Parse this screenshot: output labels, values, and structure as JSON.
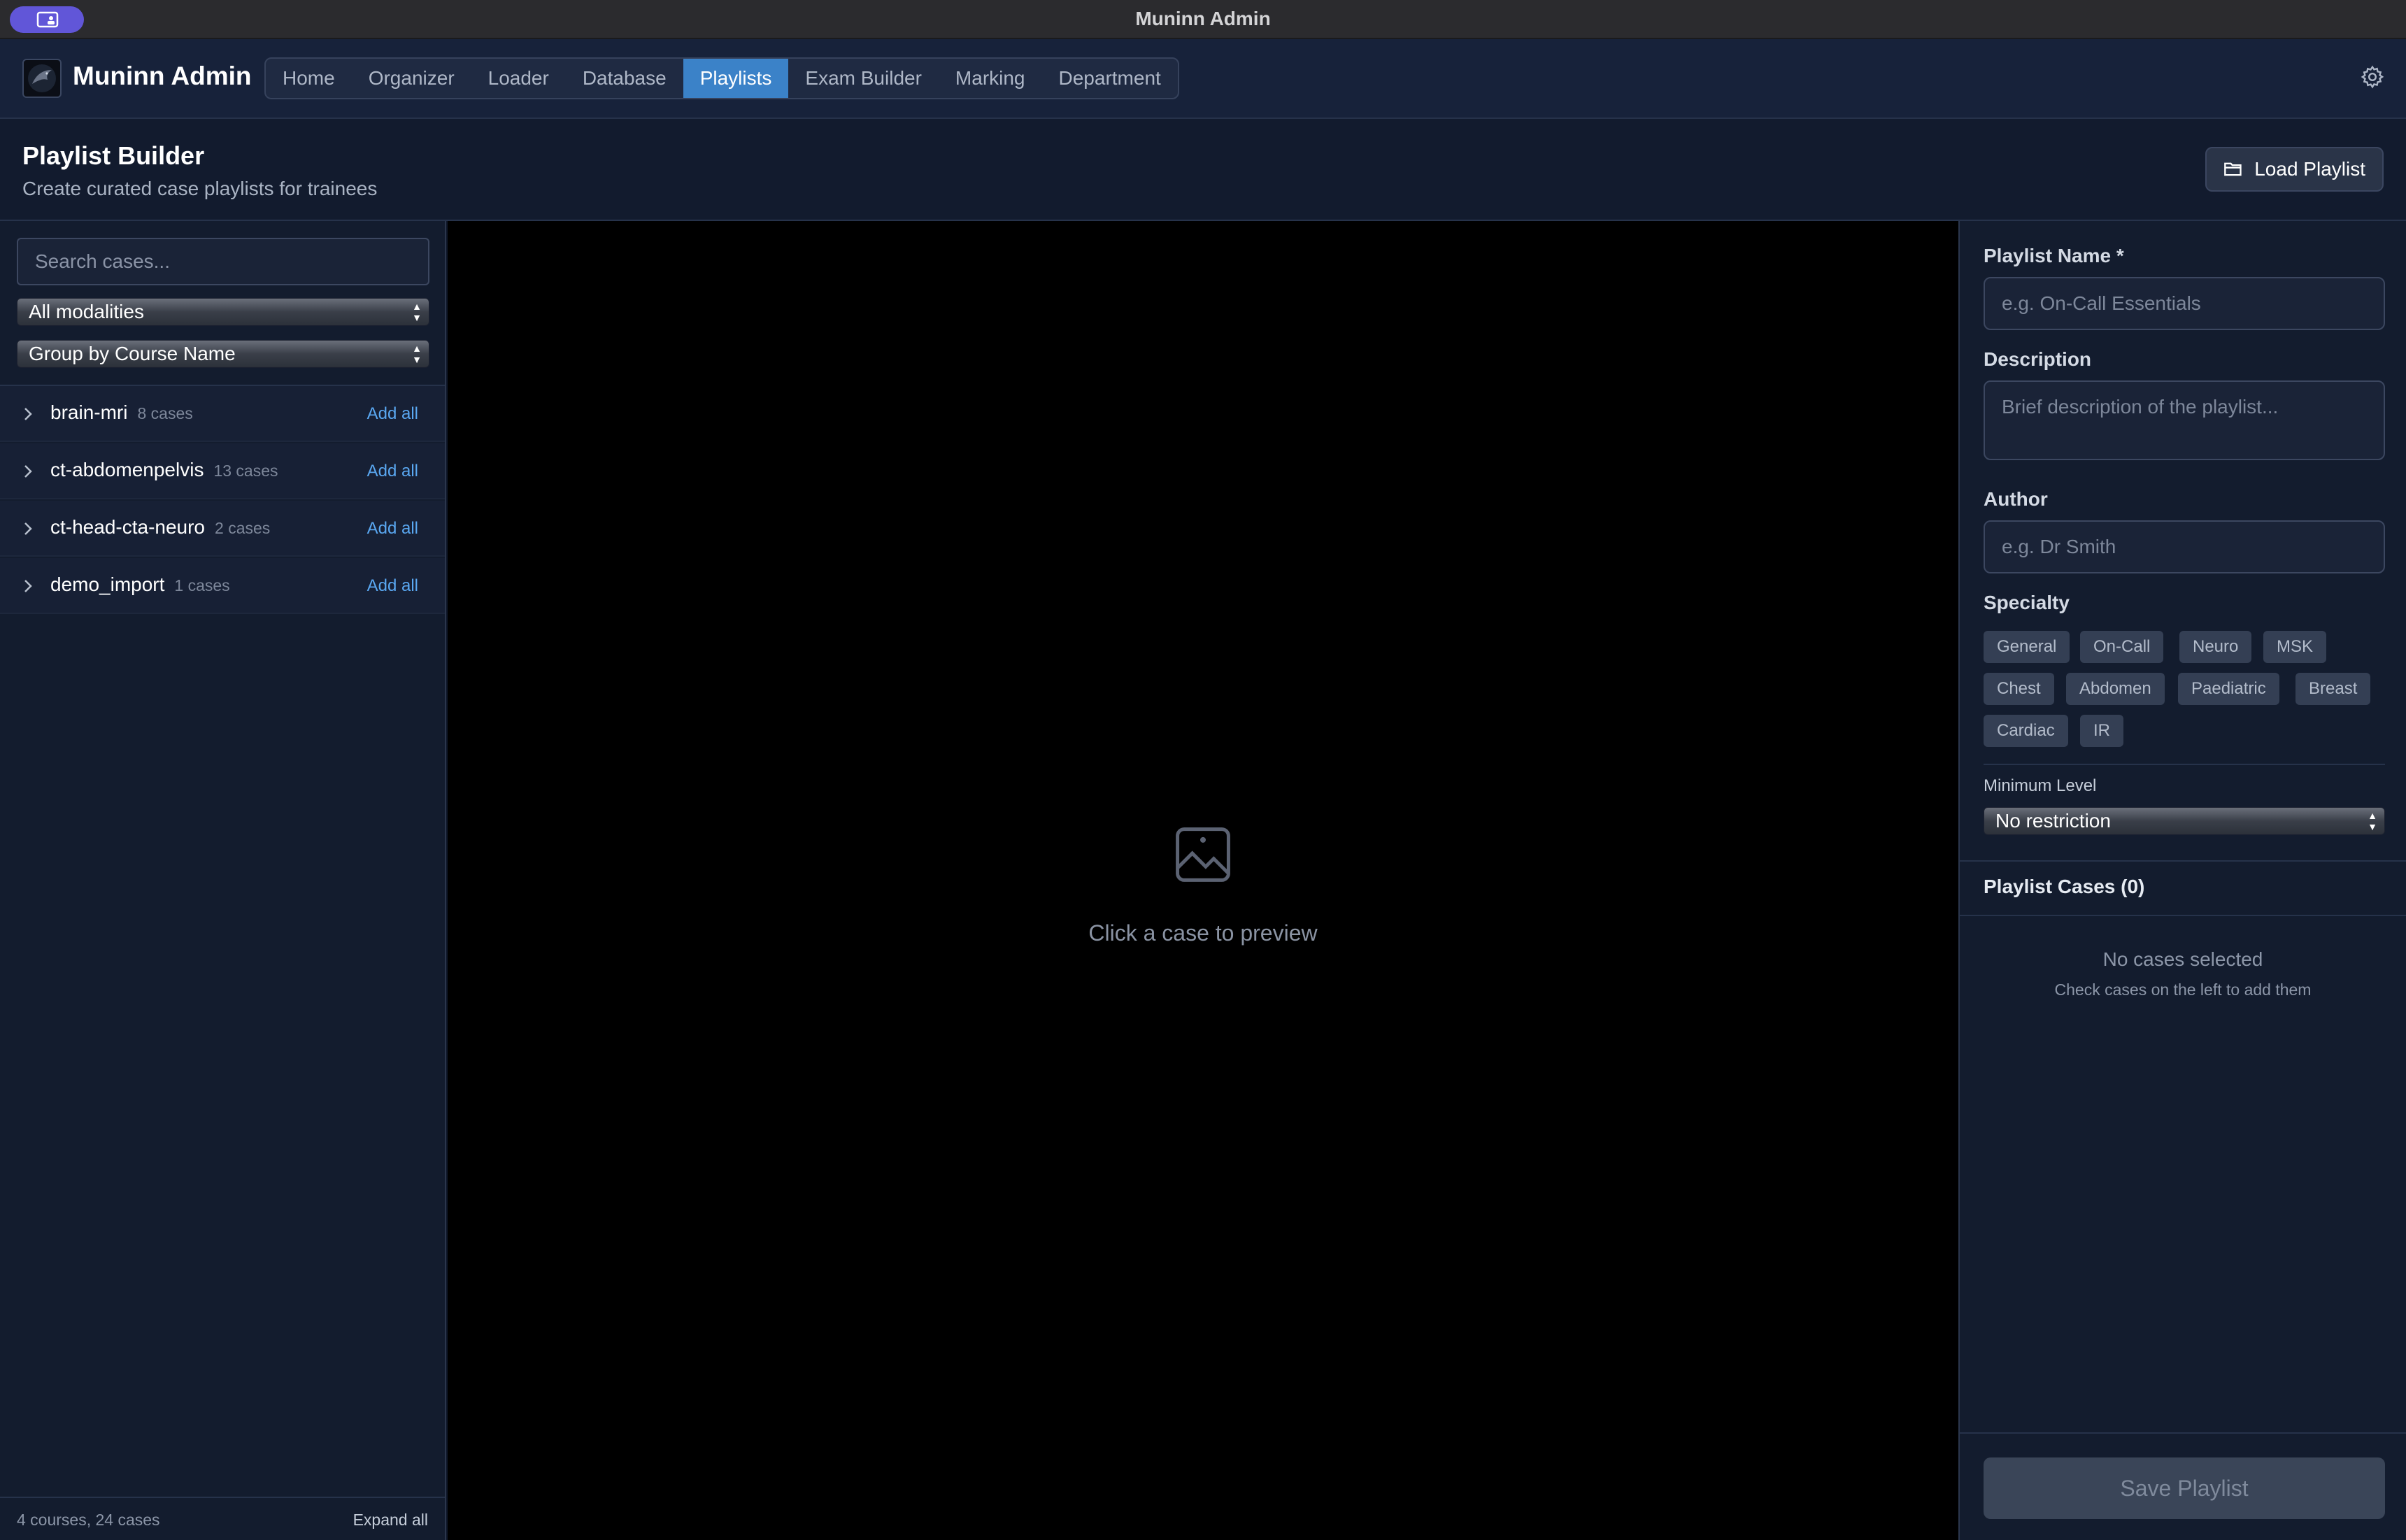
{
  "window": {
    "title": "Muninn Admin"
  },
  "header": {
    "app_name": "Muninn Admin",
    "tabs": [
      {
        "label": "Home",
        "active": false
      },
      {
        "label": "Organizer",
        "active": false
      },
      {
        "label": "Loader",
        "active": false
      },
      {
        "label": "Database",
        "active": false
      },
      {
        "label": "Playlists",
        "active": true
      },
      {
        "label": "Exam Builder",
        "active": false
      },
      {
        "label": "Marking",
        "active": false
      },
      {
        "label": "Department",
        "active": false
      }
    ],
    "settings_icon": "gear-icon"
  },
  "page": {
    "title": "Playlist Builder",
    "subtitle": "Create curated case playlists for trainees",
    "load_button": "Load Playlist"
  },
  "sidebar": {
    "search_placeholder": "Search cases...",
    "modality_select": "All modalities",
    "group_select": "Group by Course Name",
    "courses": [
      {
        "name": "brain-mri",
        "count": "8 cases",
        "action": "Add all"
      },
      {
        "name": "ct-abdomenpelvis",
        "count": "13 cases",
        "action": "Add all"
      },
      {
        "name": "ct-head-cta-neuro",
        "count": "2 cases",
        "action": "Add all"
      },
      {
        "name": "demo_import",
        "count": "1 cases",
        "action": "Add all"
      }
    ],
    "footer_stats": "4 courses, 24 cases",
    "expand_all": "Expand all"
  },
  "preview": {
    "empty_text": "Click a case to preview",
    "icon": "image-icon"
  },
  "form": {
    "name_label": "Playlist Name *",
    "name_placeholder": "e.g. On-Call Essentials",
    "description_label": "Description",
    "description_placeholder": "Brief description of the playlist...",
    "author_label": "Author",
    "author_placeholder": "e.g. Dr Smith",
    "specialty_label": "Specialty",
    "specialties": [
      "General",
      "On-Call",
      "Neuro",
      "MSK",
      "Chest",
      "Abdomen",
      "Paediatric",
      "Breast",
      "Cardiac",
      "IR"
    ],
    "min_level_label": "Minimum Level",
    "min_level_value": "No restriction",
    "cases_title": "Playlist Cases (0)",
    "empty_title": "No cases selected",
    "empty_sub": "Check cases on the left to add them",
    "save_button": "Save Playlist"
  },
  "colors": {
    "accent": "#3b82c8",
    "link": "#5aa8f2",
    "background": "#0f1729",
    "window_button": "#6156d8"
  }
}
